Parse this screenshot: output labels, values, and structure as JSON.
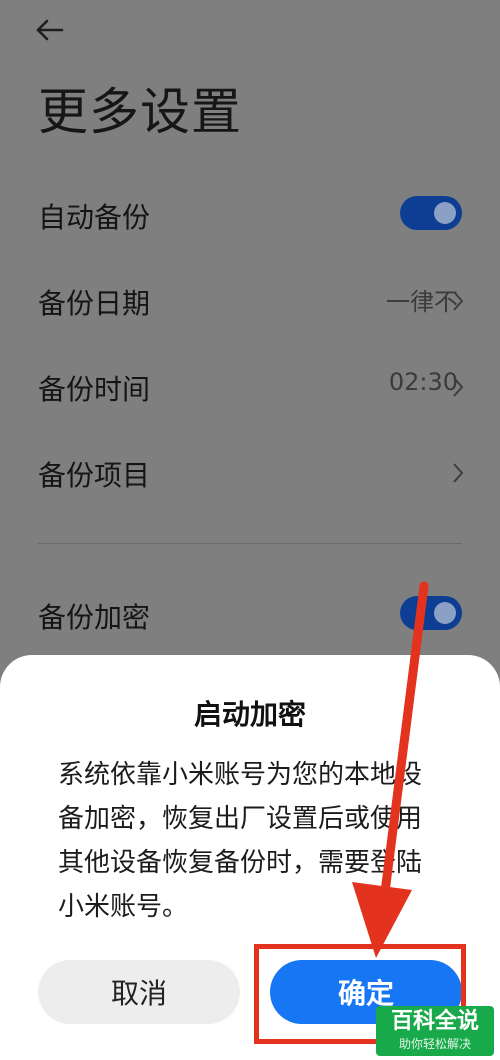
{
  "header": {
    "title": "更多设置"
  },
  "settings": {
    "auto_backup": {
      "label": "自动备份",
      "enabled": true
    },
    "backup_date": {
      "label": "备份日期",
      "value": "一律不"
    },
    "backup_time": {
      "label": "备份时间",
      "value": "02:30"
    },
    "backup_items": {
      "label": "备份项目"
    },
    "backup_encrypt": {
      "label": "备份加密",
      "enabled": true
    }
  },
  "dialog": {
    "title": "启动加密",
    "message": "系统依靠小米账号为您的本地设备加密，恢复出厂设置后或使用其他设备恢复备份时，需要登陆小米账号。",
    "cancel_label": "取消",
    "confirm_label": "确定"
  },
  "watermark": {
    "top": "百科全说",
    "bottom": "助你轻松解决"
  },
  "colors": {
    "toggle_on": "#0d3e94",
    "confirm_button": "#1676f3",
    "annotation": "#e3321e",
    "watermark_bg": "#18a94a"
  },
  "icons": [
    "back-arrow-icon",
    "chevron-right-icon"
  ]
}
